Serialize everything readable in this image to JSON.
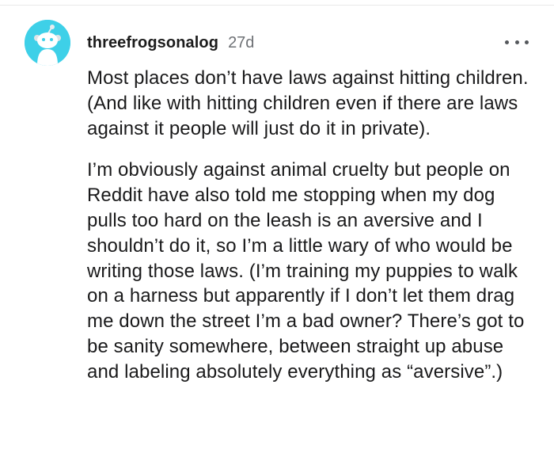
{
  "comment": {
    "username": "threefrogsonalog",
    "age": "27d",
    "avatar_icon": "snoo-avatar-icon",
    "menu_icon": "more-options-icon",
    "paragraphs": [
      "Most places don’t have laws against hitting children. (And like with hitting children even if there are laws against it people will just do it in private).",
      "I’m obviously against animal cruelty but people on Reddit have also told me stopping when my dog pulls too hard on the leash is an aversive and I shouldn’t do it, so I’m a little wary of who would be writing those laws. (I’m training my puppies to walk on a harness but apparently if I don’t let them drag me down the street I’m a bad owner? There’s got to be sanity somewhere, between straight up abuse and labeling absolutely everything as “aversive”.)"
    ]
  },
  "colors": {
    "avatar_bg": "#3ed0e8",
    "text": "#1a1a1b",
    "muted": "#6e7175"
  }
}
